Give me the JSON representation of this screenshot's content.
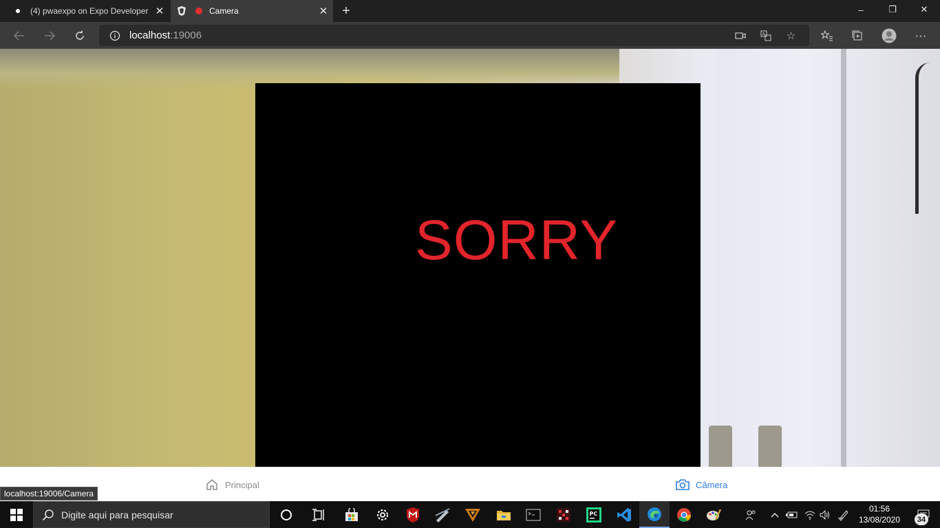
{
  "browser": {
    "tabs": [
      {
        "label": "(4) pwaexpo on Expo Developer",
        "active": false
      },
      {
        "label": "Camera",
        "active": true
      }
    ],
    "new_tab_symbol": "+",
    "window_controls": {
      "minimize": "–",
      "restore": "❐",
      "close": "✕"
    },
    "address": {
      "host": "localhost",
      "port": ":19006"
    },
    "status_url": "localhost:19006/Camera"
  },
  "page": {
    "message": "SORRY",
    "message_color": "#e2242b",
    "nav": {
      "home_label": "Principal",
      "camera_label": "Câmera",
      "active": "camera",
      "active_color": "#2a7be4"
    }
  },
  "taskbar": {
    "search_placeholder": "Digite aqui para pesquisar",
    "time": "01:56",
    "date": "13/08/2020",
    "notification_count": "34",
    "apps": [
      "task-view",
      "store",
      "settings",
      "mcafee",
      "app",
      "game",
      "file-explorer",
      "terminal",
      "puzzle",
      "pycharm",
      "vscode",
      "edge",
      "chrome",
      "paint"
    ]
  }
}
